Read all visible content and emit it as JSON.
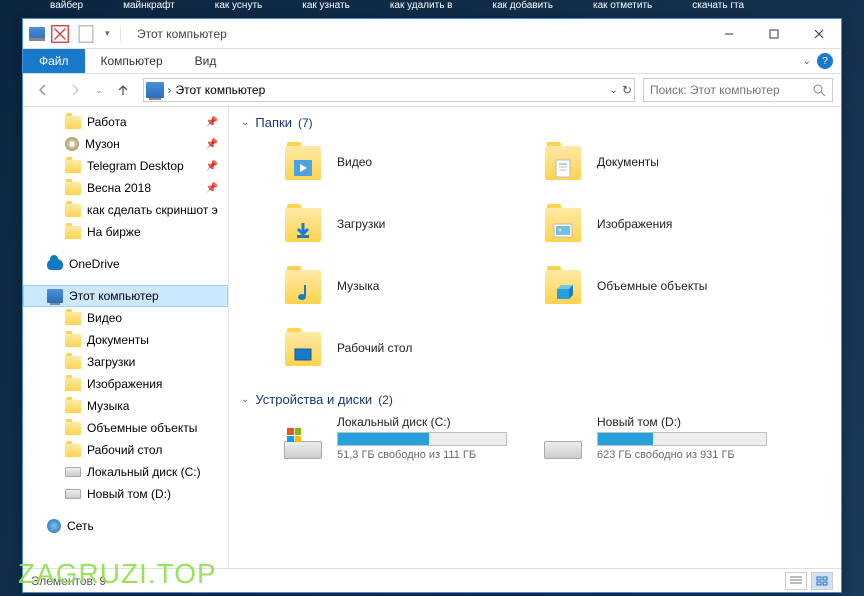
{
  "desktop_labels": [
    "вайбер",
    "майнкрафт",
    "как уснуть",
    "как узнать",
    "как удалить в",
    "как добавить",
    "как отметить",
    "скачать гта"
  ],
  "window": {
    "title": "Этот компьютер",
    "controls": {
      "min": "–",
      "max": "▢",
      "close": "✕"
    }
  },
  "tabs": {
    "file": "Файл",
    "computer": "Компьютер",
    "view": "Вид"
  },
  "address": {
    "arrow": "›",
    "location": "Этот компьютер"
  },
  "search_placeholder": "Поиск: Этот компьютер",
  "sidebar": {
    "quick": [
      {
        "label": "Работа",
        "pinned": true
      },
      {
        "label": "Музон",
        "pinned": true,
        "icon": "disc"
      },
      {
        "label": "Telegram Desktop",
        "pinned": true
      },
      {
        "label": "Весна 2018",
        "pinned": true
      },
      {
        "label": "как сделать скриншот э"
      },
      {
        "label": "На бирже"
      }
    ],
    "onedrive": "OneDrive",
    "this_pc": "Этот компьютер",
    "pc_children": [
      {
        "label": "Видео"
      },
      {
        "label": "Документы"
      },
      {
        "label": "Загрузки"
      },
      {
        "label": "Изображения"
      },
      {
        "label": "Музыка"
      },
      {
        "label": "Объемные объекты"
      },
      {
        "label": "Рабочий стол"
      },
      {
        "label": "Локальный диск (C:)",
        "icon": "drive"
      },
      {
        "label": "Новый том (D:)",
        "icon": "drive"
      }
    ],
    "network": "Сеть"
  },
  "groups": {
    "folders": {
      "title": "Папки",
      "count": "(7)"
    },
    "drives": {
      "title": "Устройства и диски",
      "count": "(2)"
    }
  },
  "folders": [
    {
      "label": "Видео"
    },
    {
      "label": "Документы"
    },
    {
      "label": "Загрузки"
    },
    {
      "label": "Изображения"
    },
    {
      "label": "Музыка"
    },
    {
      "label": "Объемные объекты"
    },
    {
      "label": "Рабочий стол"
    }
  ],
  "drives": [
    {
      "name": "Локальный диск (C:)",
      "fill_pct": 54,
      "free": "51,3 ГБ свободно из 111 ГБ",
      "os": true
    },
    {
      "name": "Новый том (D:)",
      "fill_pct": 33,
      "free": "623 ГБ свободно из 931 ГБ",
      "os": false
    }
  ],
  "statusbar": {
    "items": "Элементов: 9"
  },
  "watermark": "ZAGRUZI.TOP"
}
